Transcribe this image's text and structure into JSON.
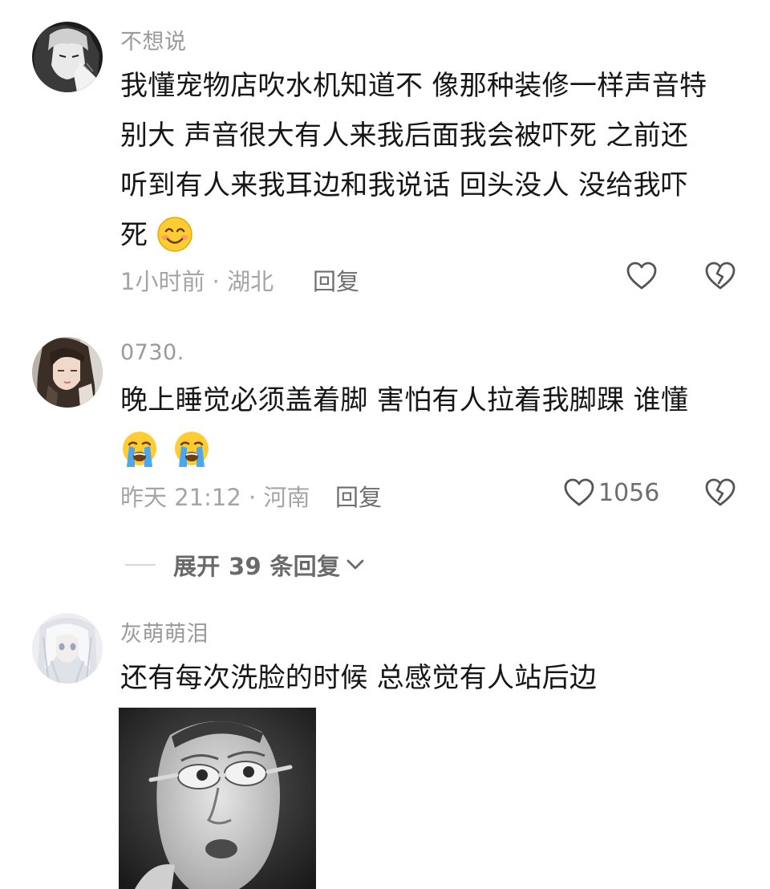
{
  "comments": [
    {
      "username": "不想说",
      "text_lines": [
        "我懂宠物店吹水机知道不 像那种装修一样声音特",
        "别大 声音很大有人来我后面我会被吓死 之前还",
        "听到有人来我耳边和我说话 回头没人 没给我吓",
        "死"
      ],
      "emojis": [
        "smiling-emoji"
      ],
      "time": "1小时前",
      "location": "湖北",
      "meta": "1小时前 · 湖北",
      "reply_label": "回复",
      "like_count": ""
    },
    {
      "username": "0730.",
      "text_lines": [
        "晚上睡觉必须盖着脚 害怕有人拉着我脚踝 谁懂"
      ],
      "emojis": [
        "loudly-crying-emoji",
        "loudly-crying-emoji"
      ],
      "time": "昨天 21:12",
      "location": "河南",
      "meta": "昨天 21:12 · 河南",
      "reply_label": "回复",
      "like_count": "1056"
    },
    {
      "username": "灰萌萌泪",
      "text_lines": [
        "还有每次洗脸的时候 总感觉有人站后边"
      ],
      "emojis": [],
      "sticker": "scared-face-meme-sticker"
    }
  ],
  "expand_replies": {
    "label": "展开 39 条回复"
  },
  "colors": {
    "username": "#9a9a9a",
    "body_text": "#161616",
    "meta": "#a5a5a5",
    "action": "#6e6e6e",
    "background": "#ffffff"
  }
}
